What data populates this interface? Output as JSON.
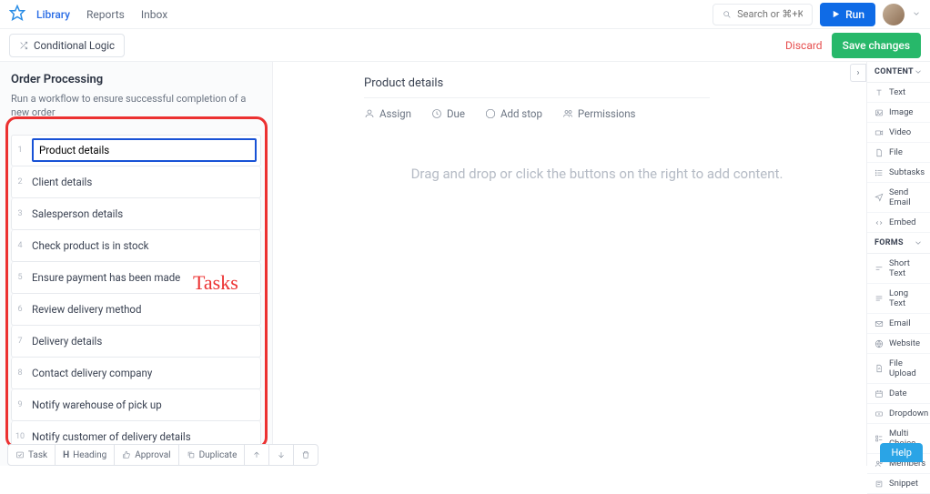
{
  "nav": {
    "links": [
      "Library",
      "Reports",
      "Inbox"
    ],
    "active_index": 0,
    "search_placeholder": "Search or ⌘+K",
    "run_label": "Run"
  },
  "subbar": {
    "conditional_logic": "Conditional Logic",
    "discard": "Discard",
    "save": "Save changes"
  },
  "workflow": {
    "title": "Order Processing",
    "description": "Run a workflow to ensure successful completion of a new order",
    "tasks": [
      "Product details",
      "Client details",
      "Salesperson details",
      "Check product is in stock",
      "Ensure payment has been made",
      "Review delivery method",
      "Delivery details",
      "Contact delivery company",
      "Notify warehouse of pick up",
      "Notify customer of delivery details"
    ],
    "active_task_index": 0
  },
  "bottombar": {
    "task": "Task",
    "heading": "Heading",
    "approval": "Approval",
    "duplicate": "Duplicate"
  },
  "detail": {
    "title": "Product details",
    "actions": {
      "assign": "Assign",
      "due": "Due",
      "add_stop": "Add stop",
      "permissions": "Permissions"
    },
    "placeholder": "Drag and drop or click the buttons on the right to add content."
  },
  "right_panel": {
    "content_head": "CONTENT",
    "forms_head": "FORMS",
    "content": [
      "Text",
      "Image",
      "Video",
      "File",
      "Subtasks",
      "Send Email",
      "Embed"
    ],
    "forms": [
      "Short Text",
      "Long Text",
      "Email",
      "Website",
      "File Upload",
      "Date",
      "Dropdown",
      "Multi Choice",
      "Members",
      "Snippet"
    ]
  },
  "annotation": {
    "label": "Tasks"
  },
  "help": "Help"
}
